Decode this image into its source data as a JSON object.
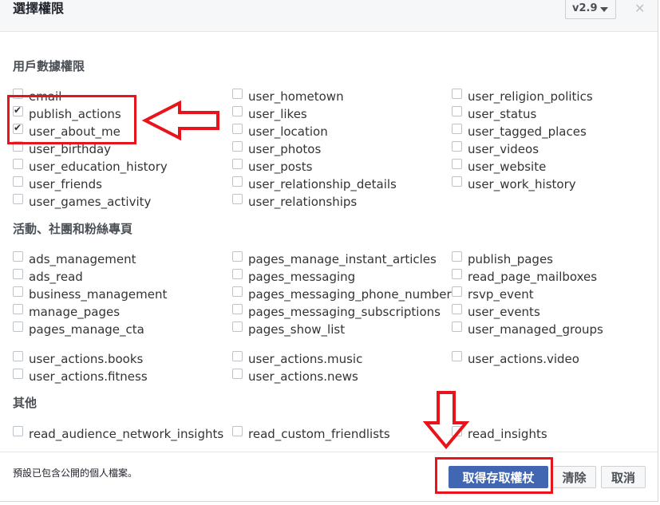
{
  "dialog": {
    "title": "選擇權限",
    "version": "v2.9",
    "close_glyph": "✕"
  },
  "sections": [
    {
      "title": "用戶數據權限"
    },
    {
      "title": "活動、社團和粉絲專頁"
    },
    {
      "title": "其他"
    }
  ],
  "user_permissions": {
    "col1": [
      {
        "label": "email",
        "checked": false
      },
      {
        "label": "publish_actions",
        "checked": true
      },
      {
        "label": "user_about_me",
        "checked": true
      },
      {
        "label": "user_birthday",
        "checked": false
      },
      {
        "label": "user_education_history",
        "checked": false
      },
      {
        "label": "user_friends",
        "checked": false
      },
      {
        "label": "user_games_activity",
        "checked": false
      }
    ],
    "col2": [
      {
        "label": "user_hometown",
        "checked": false
      },
      {
        "label": "user_likes",
        "checked": false
      },
      {
        "label": "user_location",
        "checked": false
      },
      {
        "label": "user_photos",
        "checked": false
      },
      {
        "label": "user_posts",
        "checked": false
      },
      {
        "label": "user_relationship_details",
        "checked": false
      },
      {
        "label": "user_relationships",
        "checked": false
      }
    ],
    "col3": [
      {
        "label": "user_religion_politics",
        "checked": false
      },
      {
        "label": "user_status",
        "checked": false
      },
      {
        "label": "user_tagged_places",
        "checked": false
      },
      {
        "label": "user_videos",
        "checked": false
      },
      {
        "label": "user_website",
        "checked": false
      },
      {
        "label": "user_work_history",
        "checked": false
      }
    ]
  },
  "page_permissions": {
    "col1": [
      {
        "label": "ads_management"
      },
      {
        "label": "ads_read"
      },
      {
        "label": "business_management"
      },
      {
        "label": "manage_pages"
      },
      {
        "label": "pages_manage_cta"
      }
    ],
    "col2": [
      {
        "label": "pages_manage_instant_articles"
      },
      {
        "label": "pages_messaging"
      },
      {
        "label": "pages_messaging_phone_number"
      },
      {
        "label": "pages_messaging_subscriptions"
      },
      {
        "label": "pages_show_list"
      }
    ],
    "col3": [
      {
        "label": "publish_pages"
      },
      {
        "label": "read_page_mailboxes"
      },
      {
        "label": "rsvp_event"
      },
      {
        "label": "user_events"
      },
      {
        "label": "user_managed_groups"
      }
    ]
  },
  "actions_permissions": {
    "col1": [
      {
        "label": "user_actions.books"
      },
      {
        "label": "user_actions.fitness"
      }
    ],
    "col2": [
      {
        "label": "user_actions.music"
      },
      {
        "label": "user_actions.news"
      }
    ],
    "col3": [
      {
        "label": "user_actions.video"
      }
    ]
  },
  "other_permissions": {
    "col1": [
      {
        "label": "read_audience_network_insights"
      }
    ],
    "col2": [
      {
        "label": "read_custom_friendlists"
      }
    ],
    "col3": [
      {
        "label": "read_insights"
      }
    ]
  },
  "footer": {
    "note": "預設已包含公開的個人檔案。",
    "get_token_label": "取得存取權杖",
    "clear_label": "清除",
    "cancel_label": "取消"
  },
  "annotation_color": "#e8141c",
  "primary_color": "#4267b2",
  "check_glyph": "✔"
}
